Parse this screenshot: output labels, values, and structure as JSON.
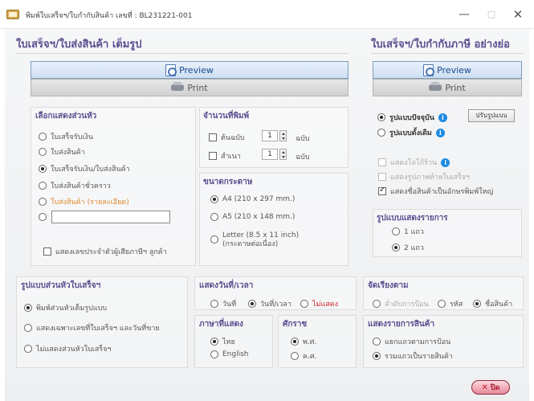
{
  "window": {
    "title": "พิมพ์ใบเสร็จฯ/ใบกำกับสินค้า เลขที่ : BL231221-001",
    "controls": {
      "minimize": "—",
      "maximize": "□",
      "close": "✕"
    }
  },
  "left": {
    "heading": "ใบเสร็จฯ/ใบส่งสินค้า เต็มรูป",
    "preview_label": "Preview",
    "print_label": "Print",
    "header_group": {
      "title": "เลือกแสดงส่วนหัว",
      "options": [
        "ใบเสร็จรับเงิน",
        "ใบส่งสินค้า",
        "ใบเสร็จรับเงิน/ใบส่งสินค้า",
        "ใบส่งสินค้าชั่วคราว",
        "ใบส่งสินค้า (รายละเอียด)"
      ],
      "custom_value": "",
      "selected": 2,
      "taxid_label": "แสดงเลขประจำตัวผู้เสียภาษีฯ ลูกค้า"
    },
    "copies": {
      "title": "จำนวนที่พิมพ์",
      "original_label": "ต้นฉบับ",
      "original_value": "1",
      "copy_label": "สำเนา",
      "copy_value": "1",
      "unit": "ฉบับ"
    },
    "paper": {
      "title": "ขนาดกระดาษ",
      "options": [
        "A4 (210 x 297 mm.)",
        "A5 (210 x 148 mm.)",
        "Letter (8.5 x 11 inch)"
      ],
      "letter_note": "(กระดาษต่อเนื่อง)",
      "selected": 0
    }
  },
  "right": {
    "heading": "ใบเสร็จฯ/ใบกำกับภาษี อย่างย่อ",
    "preview_label": "Preview",
    "print_label": "Print",
    "format_current": "รูปแบบปัจจุบัน",
    "format_original": "รูปแบบดั้งเดิม",
    "adjust_button": "ปรับรูปแบบ",
    "show_logo": "แสดงโลโก้ร้าน",
    "show_footer_image": "แสดงรูปภาพท้ายใบเสร็จฯ",
    "show_large_name": "แสดงชื่อสินค้าเป็นอักษรพิมพ์ใหญ่",
    "list_format": {
      "title": "รูปแบบแสดงรายการ",
      "options": [
        "1 แถว",
        "2 แถว"
      ],
      "selected": 1
    }
  },
  "bottom": {
    "header_style": {
      "title": "รูปแบบส่วนหัวใบเสร็จฯ",
      "options": [
        "พิมพ์ส่วนหัวเต็มรูปแบบ",
        "แสดงเฉพาะเลขที่ใบเสร็จฯ และวันที่ขาย",
        "ไม่แสดงส่วนหัวใบเสร็จฯ"
      ],
      "selected": 0
    },
    "datetime": {
      "title": "แสดงวันที่/เวลา",
      "options": [
        "วันที่",
        "วันที่/เวลา",
        "ไม่แสดง"
      ],
      "selected": 1
    },
    "language": {
      "title": "ภาษาที่แสดง",
      "options": [
        "ไทย",
        "English"
      ],
      "selected": 0
    },
    "era": {
      "title": "ศักราช",
      "options": [
        "พ.ศ.",
        "ค.ศ."
      ],
      "selected": 0
    },
    "sort": {
      "title": "จัดเรียงตาม",
      "options": [
        "ลำดับการป้อน",
        "รหัส",
        "ชื่อสินค้า"
      ],
      "selected": 2
    },
    "item_display": {
      "title": "แสดงรายการสินค้า",
      "options": [
        "แยกแถวตามการป้อน",
        "รวมแถวเป็นรายสินค้า"
      ],
      "selected": 1
    }
  },
  "close_label": "ปิด"
}
